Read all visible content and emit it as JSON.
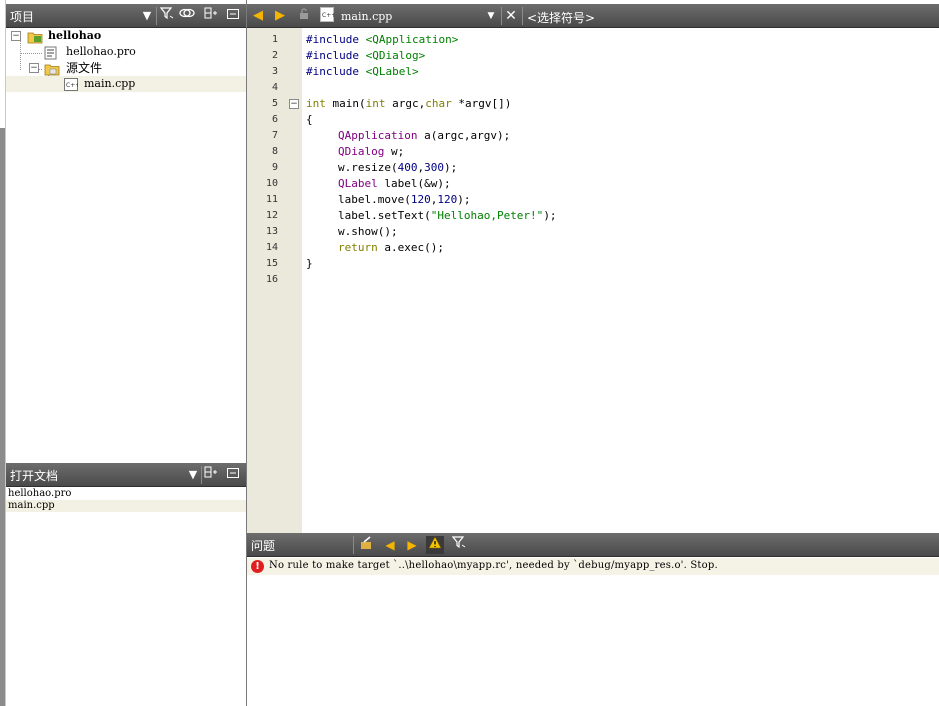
{
  "project_panel": {
    "title": "项目",
    "tree": {
      "root": "hellohao",
      "pro_file": "hellohao.pro",
      "source_folder": "源文件",
      "source_file": "main.cpp"
    }
  },
  "docs_panel": {
    "title": "打开文档",
    "items": [
      "hellohao.pro",
      "main.cpp"
    ]
  },
  "editor": {
    "file_combo": "main.cpp",
    "symbol_combo": "<选择符号>",
    "line_numbers": [
      "1",
      "2",
      "3",
      "4",
      "5",
      "6",
      "7",
      "8",
      "9",
      "10",
      "11",
      "12",
      "13",
      "14",
      "15",
      "16"
    ],
    "code": {
      "l1_pp": "#include ",
      "l1_inc": "<QApplication>",
      "l2_pp": "#include ",
      "l2_inc": "<QDialog>",
      "l3_pp": "#include ",
      "l3_inc": "<QLabel>",
      "l5_kw1": "int",
      "l5_a": " main(",
      "l5_kw2": "int",
      "l5_b": " argc,",
      "l5_kw3": "char",
      "l5_c": " *argv[])",
      "l6": "{",
      "l7_cls": "QApplication",
      "l7_rest": " a(argc,argv);",
      "l8_cls": "QDialog",
      "l8_rest": " w;",
      "l9_a": "w.resize(",
      "l9_n1": "400",
      "l9_b": ",",
      "l9_n2": "300",
      "l9_c": ");",
      "l10_cls": "QLabel",
      "l10_rest": " label(&w);",
      "l11_a": "label.move(",
      "l11_n1": "120",
      "l11_b": ",",
      "l11_n2": "120",
      "l11_c": ");",
      "l12_a": "label.setText(",
      "l12_str": "\"Hellohao,Peter!\"",
      "l12_b": ");",
      "l13": "w.show();",
      "l14_kw": "return",
      "l14_rest": " a.exec();",
      "l15": "}"
    }
  },
  "issues_panel": {
    "title": "问题",
    "message": "No rule to make target `..\\hellohao\\myapp.rc', needed by `debug/myapp_res.o'.  Stop."
  },
  "colors": {
    "header_bg": "#5a5a5a",
    "gutter_bg": "#ebe8dc",
    "keyword": "#808000",
    "class": "#800080",
    "string": "#008000",
    "error": "#e02020"
  }
}
